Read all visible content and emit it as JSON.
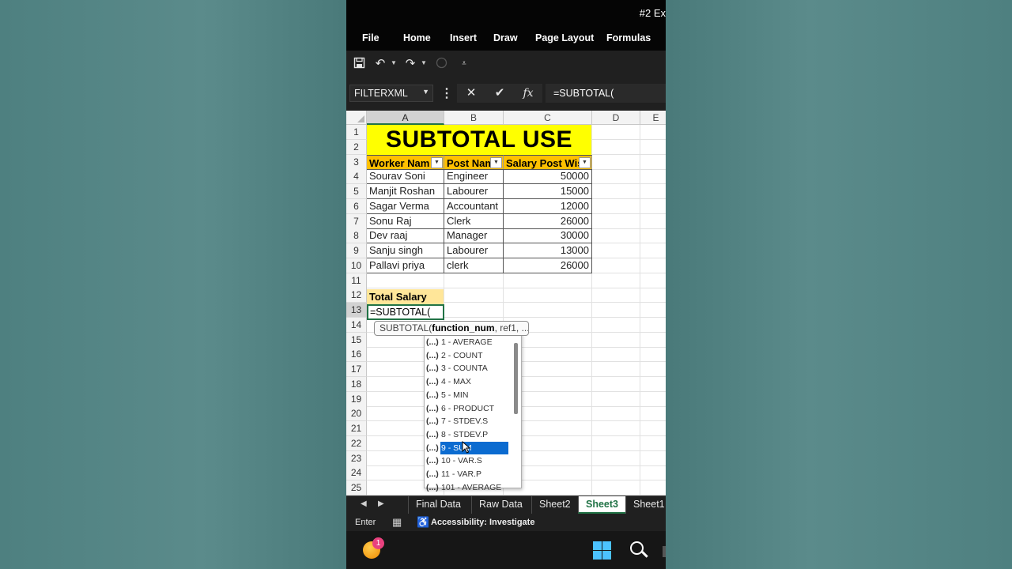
{
  "window": {
    "title": "#2 Ex"
  },
  "ribbon": {
    "tabs": [
      "File",
      "Home",
      "Insert",
      "Draw",
      "Page Layout",
      "Formulas"
    ]
  },
  "quick_access": {
    "icons": [
      "save-icon",
      "undo-icon",
      "redo-icon",
      "circle-icon",
      "customize-icon"
    ]
  },
  "formula_bar": {
    "name_box": "FILTERXML",
    "formula": "=SUBTOTAL("
  },
  "sheet": {
    "columns": [
      "A",
      "B",
      "C",
      "D",
      "E"
    ],
    "rows": [
      "1",
      "2",
      "3",
      "4",
      "5",
      "6",
      "7",
      "8",
      "9",
      "10",
      "11",
      "12",
      "13",
      "14",
      "15",
      "16",
      "17",
      "18",
      "19",
      "20",
      "21",
      "22",
      "23",
      "24",
      "25"
    ],
    "title": "SUBTOTAL USE",
    "headers": [
      "Worker Nam",
      "Post Nam",
      "Salary Post Wis"
    ],
    "data": [
      [
        "Sourav Soni",
        "Engineer",
        "50000"
      ],
      [
        "Manjit Roshan",
        "Labourer",
        "15000"
      ],
      [
        "Sagar Verma",
        "Accountant",
        "12000"
      ],
      [
        "Sonu Raj",
        "Clerk",
        "26000"
      ],
      [
        "Dev raaj",
        "Manager",
        "30000"
      ],
      [
        "Sanju singh",
        "Labourer",
        "13000"
      ],
      [
        "Pallavi priya",
        "clerk",
        "26000"
      ]
    ],
    "total_label": "Total Salary",
    "active_cell_text": "=SUBTOTAL(",
    "active_row": "13"
  },
  "tooltip": {
    "prefix": "SUBTOTAL(",
    "bold": "function_num",
    "suffix": ", ref1, ..."
  },
  "autocomplete": {
    "icon": "(...)",
    "items": [
      "1 - AVERAGE",
      "2 - COUNT",
      "3 - COUNTA",
      "4 - MAX",
      "5 - MIN",
      "6 - PRODUCT",
      "7 - STDEV.S",
      "8 - STDEV.P",
      "9 - SUM",
      "10 - VAR.S",
      "11 - VAR.P",
      "101 - AVERAGE"
    ],
    "selected": "9 - SUM"
  },
  "sheet_tabs": {
    "tabs": [
      "Final Data",
      "Raw Data",
      "Sheet2",
      "Sheet3",
      "Sheet1"
    ],
    "active": "Sheet3"
  },
  "status_bar": {
    "mode": "Enter",
    "accessibility": "Accessibility: Investigate"
  },
  "taskbar": {
    "badge": "1"
  },
  "colors": {
    "title_fill": "#ffff00",
    "header_fill": "#ffc000",
    "total_fill": "#ffe699",
    "excel_green": "#217346",
    "selection_blue": "#0b6bd0"
  }
}
